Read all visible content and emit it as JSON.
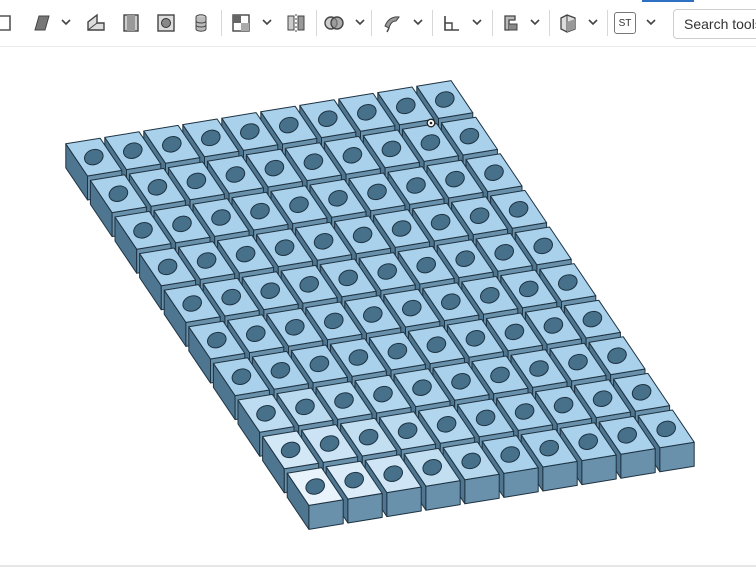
{
  "toolbar": {
    "search_label": "Search tools",
    "sketch_badge": "ST",
    "tools": [
      "sketch-icon",
      "extrude-icon",
      "revolve-icon",
      "sweep-icon",
      "fillet-icon",
      "shell-icon",
      "pattern-icon",
      "mirror-icon",
      "boolean-icon",
      "transform-icon",
      "plane-icon",
      "sheet-metal-icon",
      "part-studio-icon"
    ],
    "accent": "#2f6fc4"
  },
  "model": {
    "rows": 10,
    "cols": 10,
    "top_color": "#a9d1ec",
    "top_highlight": "#e8f3fb",
    "side_color": "#4f7690",
    "front_color": "#6a91ab",
    "hole_color": "#47708a",
    "edge_color": "#1e3342"
  }
}
